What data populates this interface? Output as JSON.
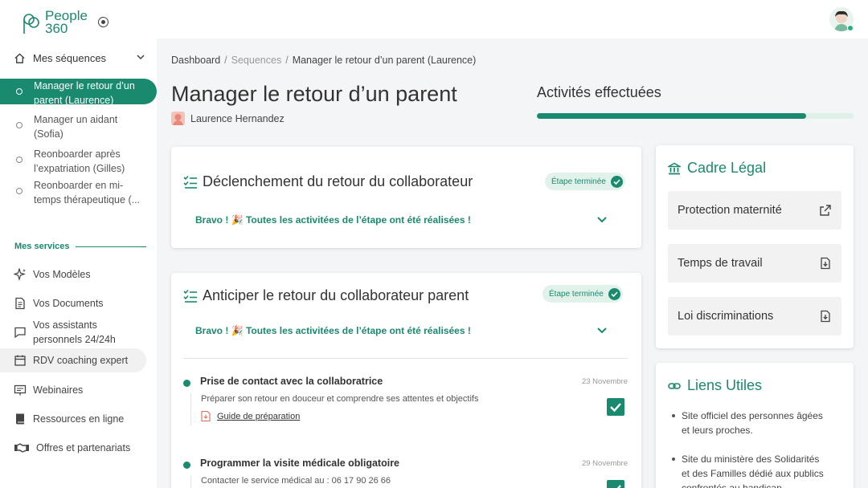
{
  "brand": {
    "line1": "People",
    "line2": "360",
    "accent": "#1a8a6e"
  },
  "sidebar": {
    "sequences_label": "Mes séquences",
    "sequences": [
      {
        "line1": "Manager le retour d’un",
        "line2": "parent (Laurence)",
        "active": true
      },
      {
        "line1": "Manager un aidant",
        "line2": "(Sofia)"
      },
      {
        "line1": "Reonboarder après",
        "line2": "l’expatriation (Gilles)"
      },
      {
        "line1": "Reonboarder en mi-",
        "line2": "temps thérapeutique (..."
      }
    ],
    "services_label": "Mes services",
    "services": [
      {
        "label": "Vos Modèles",
        "icon": "sparkles-icon"
      },
      {
        "label": "Vos Documents",
        "icon": "document-icon"
      },
      {
        "line1": "Vos assistants",
        "line2": "personnels 24/24h",
        "icon": "chat-icon"
      },
      {
        "label": "RDV coaching expert",
        "icon": "calendar-icon"
      },
      {
        "label": "Webinaires",
        "icon": "presentation-icon"
      },
      {
        "label": "Ressources en ligne",
        "icon": "book-icon"
      },
      {
        "label": "Offres et partenariats",
        "icon": "handshake-icon"
      }
    ]
  },
  "breadcrumb": {
    "home": "Dashboard",
    "section": "Sequences",
    "current": "Manager le retour d’un parent (Laurence)"
  },
  "page": {
    "title": "Manager le retour d’un parent",
    "person": "Laurence Hernandez"
  },
  "progress": {
    "label": "Activités effectuées",
    "fraction": 0.85
  },
  "steps": [
    {
      "title": "Déclenchement du retour du collaborateur",
      "badge": "Étape terminée",
      "bravo": "Bravo ! 🎉  Toutes les activitées de l’étape ont été réalisées !"
    },
    {
      "title": "Anticiper le retour du collaborateur parent",
      "badge": "Étape terminée",
      "bravo": "Bravo ! 🎉  Toutes les activitées de l’étape ont été réalisées !",
      "activities": [
        {
          "title": "Prise de contact avec la collaboratrice",
          "date": "23 Novembre",
          "desc": "Préparer son retour en douceur et comprendre ses attentes et objectifs",
          "resource": "Guide de préparation",
          "done": true
        },
        {
          "title": "Programmer la visite médicale obligatoire",
          "date": "29 Novembre",
          "desc": "Contacter le service médical au : 06 17 90 26 66",
          "done": true
        }
      ]
    }
  ],
  "legal": {
    "title": "Cadre Légal",
    "items": [
      {
        "label": "Protection maternité",
        "icon": "external-link-icon"
      },
      {
        "label": "Temps de travail",
        "icon": "file-download-icon"
      },
      {
        "label": "Loi discriminations",
        "icon": "file-download-icon"
      }
    ]
  },
  "links": {
    "title": "Liens Utiles",
    "items": [
      {
        "line1": "Site officiel des personnes âgées",
        "line2": "et leurs proches."
      },
      {
        "line1": "Site du ministère des Solidarités",
        "line2": "et des Familles dédié aux publics",
        "line3": "confrontés au handicap"
      }
    ]
  }
}
